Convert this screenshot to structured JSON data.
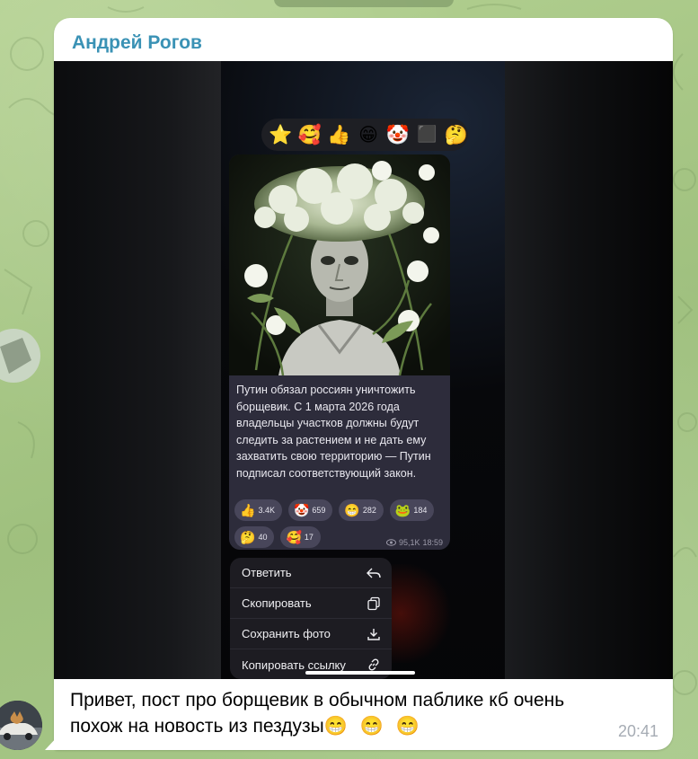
{
  "chat": {
    "sender_name": "Андрей Рогов",
    "message_text_line1": "Привет, пост про борщевик в обычном паблике кб очень",
    "message_text_line2": "похож на новость из пездузы",
    "message_emojis": "😁 😁 😁",
    "timestamp": "20:41"
  },
  "screenshot": {
    "reaction_bar": [
      "⭐",
      "🥰",
      "👍",
      "😁",
      "🤡",
      "⬛",
      "🤔"
    ],
    "post": {
      "text": "Путин обязал россиян уничтожить борщевик. С 1 марта 2026 года владельцы участков должны будут следить за растением и не дать ему захватить свою территорию — Путин подписал соответствующий закон.",
      "reactions": [
        {
          "emoji": "👍",
          "count": "3.4K"
        },
        {
          "emoji": "🤡",
          "count": "659"
        },
        {
          "emoji": "😁",
          "count": "282"
        },
        {
          "emoji": "🐸",
          "count": "184"
        },
        {
          "emoji": "🤔",
          "count": "40"
        },
        {
          "emoji": "🥰",
          "count": "17"
        }
      ],
      "views": "95,1K",
      "post_time": "18:59"
    },
    "context_menu": [
      {
        "label": "Ответить",
        "icon": "reply-icon"
      },
      {
        "label": "Скопировать",
        "icon": "copy-icon"
      },
      {
        "label": "Сохранить фото",
        "icon": "download-icon"
      },
      {
        "label": "Копировать ссылку",
        "icon": "link-icon"
      }
    ]
  },
  "colors": {
    "sender_name": "#3a92b5",
    "bubble_bg": "#ffffff",
    "timestamp": "#a6acb4",
    "post_bg": "#2d2c3b",
    "wallpaper": "#a9c98a"
  }
}
